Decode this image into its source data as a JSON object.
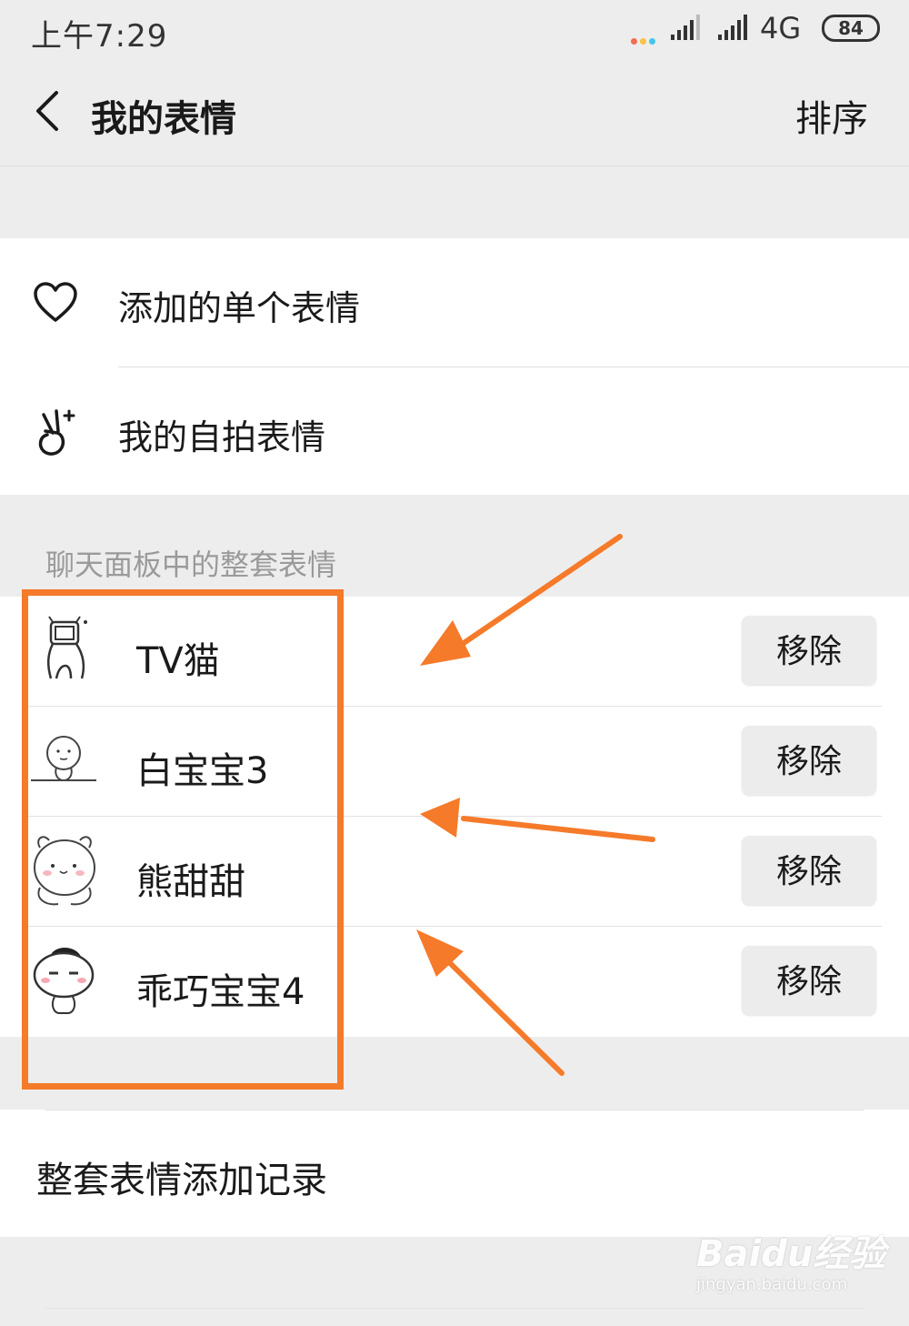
{
  "status_bar": {
    "time": "上午7:29",
    "network": "4G",
    "battery": "84",
    "dot_colors": [
      "#f26d4f",
      "#f7c342",
      "#43c5e8"
    ]
  },
  "header": {
    "title": "我的表情",
    "sort_label": "排序"
  },
  "personal": {
    "items": [
      {
        "label": "添加的单个表情",
        "icon": "heart-icon"
      },
      {
        "label": "我的自拍表情",
        "icon": "selfie-hand-icon"
      }
    ]
  },
  "chat_panel": {
    "section_label": "聊天面板中的整套表情",
    "packs": [
      {
        "name": "TV猫",
        "remove_label": "移除",
        "thumb": "tv-cat-thumbnail"
      },
      {
        "name": "白宝宝3",
        "remove_label": "移除",
        "thumb": "bai-baobao-thumbnail"
      },
      {
        "name": "熊甜甜",
        "remove_label": "移除",
        "thumb": "bear-thumbnail"
      },
      {
        "name": "乖巧宝宝4",
        "remove_label": "移除",
        "thumb": "guaiqiao-baobao-thumbnail"
      }
    ]
  },
  "history": {
    "label": "整套表情添加记录"
  },
  "annotation": {
    "color": "#f57a2a"
  },
  "watermark": {
    "logo": "Baidu经验",
    "url": "jingyan.baidu.com"
  }
}
